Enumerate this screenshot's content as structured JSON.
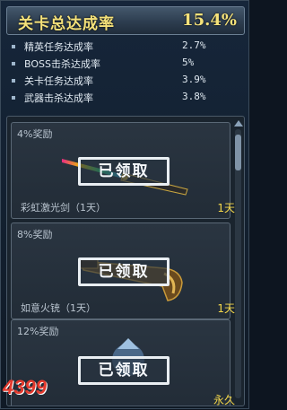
{
  "header": {
    "title": "关卡总达成率",
    "total_rate": "15.4%"
  },
  "stats": [
    {
      "label": "精英任务达成率",
      "value": "2.7%"
    },
    {
      "label": "BOSS击杀达成率",
      "value": "5%"
    },
    {
      "label": "关卡任务达成率",
      "value": "3.9%"
    },
    {
      "label": "武器击杀达成率",
      "value": "3.8%"
    }
  ],
  "rewards": [
    {
      "percent_label": "4%奖励",
      "status": "已领取",
      "item_name": "彩虹激光剑（1天）",
      "duration": "1天",
      "icon": "rainbow-laser-sword-icon"
    },
    {
      "percent_label": "8%奖励",
      "status": "已领取",
      "item_name": "如意火铳（1天）",
      "duration": "1天",
      "icon": "ruyi-firearm-icon"
    },
    {
      "percent_label": "12%奖励",
      "status": "已领取",
      "item_name": "",
      "duration": "永久",
      "icon": "pet-item-icon"
    }
  ],
  "watermark": {
    "text": "4399"
  },
  "colors": {
    "gold": "#f5e27a",
    "duration": "#f5d84a",
    "panel": "#1a242e"
  }
}
